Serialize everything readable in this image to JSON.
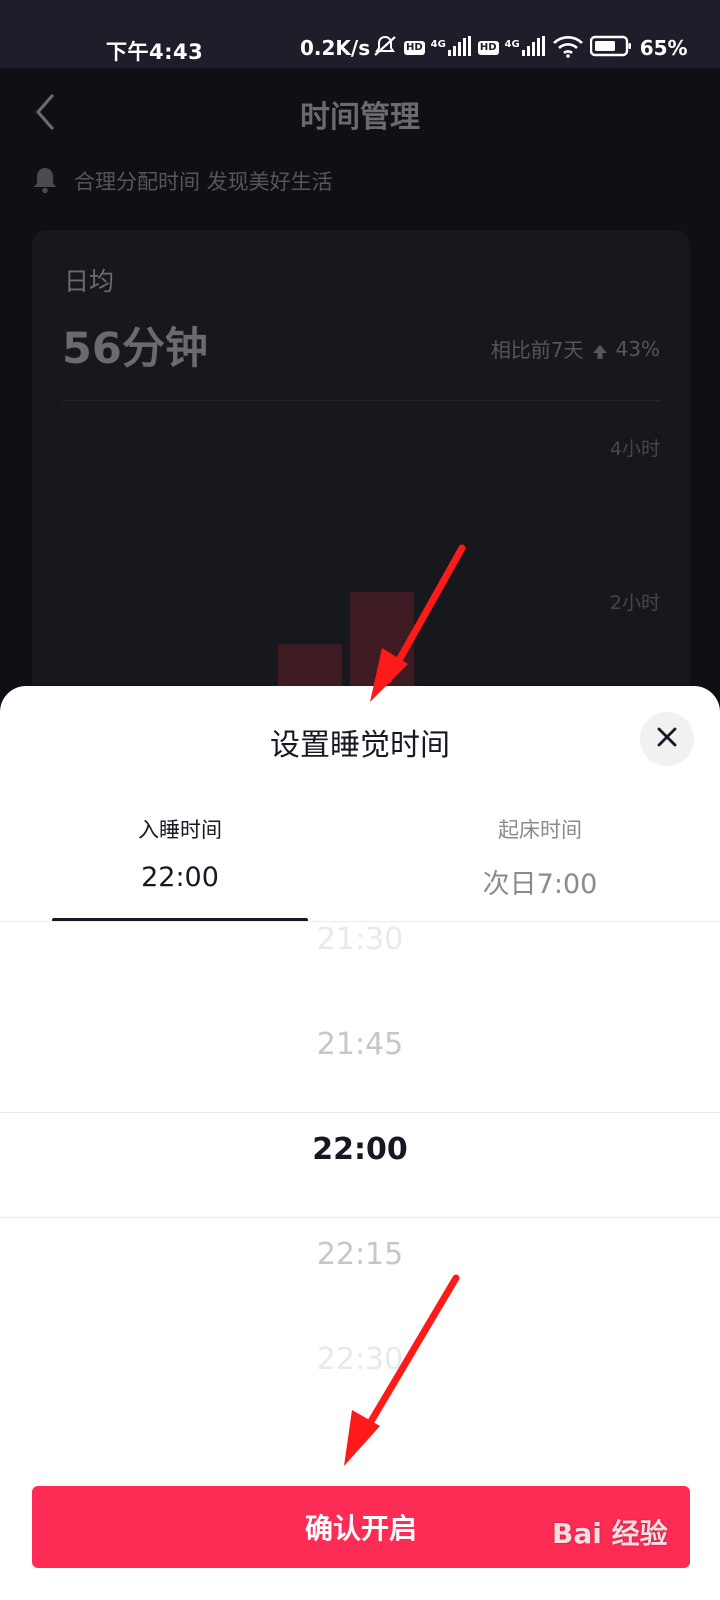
{
  "status_bar": {
    "time": "下午4:43",
    "speed": "0.2K/s",
    "hd_badge": "HD",
    "network": "4G",
    "battery": "65%"
  },
  "page": {
    "title": "时间管理",
    "tagline": "合理分配时间 发现美好生活",
    "summary": {
      "avg_label": "日均",
      "avg_value": "56分钟",
      "compare_label": "相比前7天",
      "compare_value": "43%"
    },
    "chart_data": {
      "type": "bar",
      "y_ticks": [
        "4小时",
        "2小时"
      ],
      "color": "#3e1a22"
    }
  },
  "sheet": {
    "title": "设置睡觉时间",
    "tabs": [
      {
        "label": "入睡时间",
        "value": "22:00",
        "active": true
      },
      {
        "label": "起床时间",
        "value": "次日7:00",
        "active": false
      }
    ],
    "picker": {
      "options": [
        "21:30",
        "21:45",
        "22:00",
        "22:15",
        "22:30"
      ],
      "selected": "22:00"
    },
    "confirm_label": "确认开启"
  },
  "colors": {
    "accent": "#fe2c55",
    "annotation_arrow": "#ff1a1a"
  },
  "watermark": "Bai 经验"
}
